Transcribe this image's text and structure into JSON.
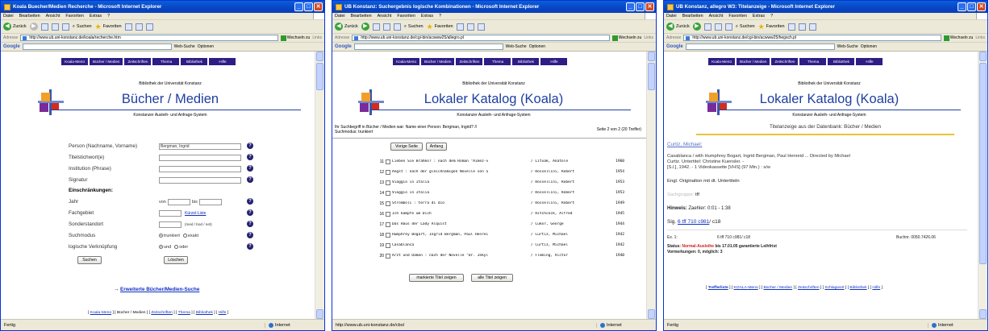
{
  "common": {
    "menu": [
      "Datei",
      "Bearbeiten",
      "Ansicht",
      "Favoriten",
      "Extras",
      "?"
    ],
    "toolbar": {
      "back": "Zurück",
      "search": "Suchen",
      "favorites": "Favoriten"
    },
    "address_label": "Adresse",
    "go_label": "Wechseln zu",
    "links_label": "Links",
    "google": {
      "logo": "Google",
      "web_search": "Web-Suche",
      "options": "Optionen"
    },
    "nav": [
      "Koala-Menü",
      "Bücher / Medien",
      "Zeitschriften",
      "Thema",
      "Bibliothek",
      "Hilfe"
    ],
    "library": "Bibliothek der Universität Konstanz",
    "subtitle": "Konstanzer Ausleih- und Anfrage-System",
    "zone": "Internet"
  },
  "win1": {
    "title": "Koala Buecher/Medien Recherche - Microsoft Internet Explorer",
    "url": "http://www.ub.uni-konstanz.de/koala/recherche.htm",
    "heading": "Bücher / Medien",
    "fields": [
      {
        "label": "Person (Nachname, Vorname)",
        "value": "Bergman, Ingrid"
      },
      {
        "label": "Titelstichwort(e)",
        "value": ""
      },
      {
        "label": "Institution (Phrase)",
        "value": ""
      },
      {
        "label": "Signatur",
        "value": ""
      }
    ],
    "restrictions": "Einschränkungen:",
    "year_label": "Jahr",
    "year_from": "von",
    "year_to": "bis",
    "subject_label": "Fachgebiet",
    "shortlist": "Kürzel-Liste",
    "location_label": "Sonderstandort",
    "location_hint": "(med / bod / net)",
    "mode_label": "Suchmodus",
    "mode_options": [
      "trunkiert",
      "exakt"
    ],
    "logic_label": "logische Verknüpfung",
    "logic_options": [
      "und",
      "oder"
    ],
    "search_btn": "Suchen",
    "clear_btn": "Löschen",
    "extended": "Erweiterte Bücher/Medien-Suche",
    "footer": [
      {
        "text": "Koala-Menü",
        "link": true
      },
      {
        "text": "Bücher / Medien",
        "link": false
      },
      {
        "text": "Zeitschriften",
        "link": true
      },
      {
        "text": "Thema",
        "link": true
      },
      {
        "text": "Bibliothek",
        "link": true
      },
      {
        "text": "Hilfe",
        "link": true
      }
    ],
    "status": "Fertig"
  },
  "win2": {
    "title": "UB Konstanz: Suchergebnis logische Kombinationen - Microsoft Internet Explorer",
    "url": "http://www.ub.uni-konstanz.de/cgi-bin/acwww25/allegro.pl",
    "heading": "Lokaler Katalog (Koala)",
    "query_line1": "Ihr Suchbegriff in Bücher / Medien war: Name einer Person: Bergman, Ingrid? //",
    "query_line2": "Suchmodus: trunkiert",
    "page_info": "Seite 2 von 2 (20 Treffer)",
    "prev_btn": "Vorige Seite",
    "start_btn": "Anfang",
    "results": [
      {
        "n": "11",
        "title": "Lieben Sie Brahms? : nach dem Roman \"Aimez-v",
        "author": "/ Litvak, Anatole",
        "year": "1960"
      },
      {
        "n": "12",
        "title": "Angst : nach der gleichnamigen Novelle von S",
        "author": "/ Rossellini, Robert",
        "year": "1954"
      },
      {
        "n": "13",
        "title": "Viaggio in Italia",
        "author": "/ Rossellini, Robert",
        "year": "1953"
      },
      {
        "n": "14",
        "title": "Viaggio in Italia",
        "author": "/ Rossellini, Robert",
        "year": "1953"
      },
      {
        "n": "15",
        "title": "Stromboli : terra di dio",
        "author": "/ Rossellini, Robert",
        "year": "1949"
      },
      {
        "n": "16",
        "title": "Ich kämpfe um Dich",
        "author": "/ Hitchcock, Alfred",
        "year": "1945"
      },
      {
        "n": "17",
        "title": "Das Haus der Lady Alquist",
        "author": "/ Cukor, George",
        "year": "1944"
      },
      {
        "n": "18",
        "title": "Humphrey Bogart, Ingrid Bergman, Paul Henrei",
        "author": "/ Curtiz, Michael",
        "year": "1942"
      },
      {
        "n": "19",
        "title": "Casablanca",
        "author": "/ Curtiz, Michael",
        "year": "1942"
      },
      {
        "n": "20",
        "title": "Arzt und Dämon : nach der Novelle \"Dr. Jekyl",
        "author": "/ Fleming, Victor",
        "year": "1940"
      }
    ],
    "show_marked": "markierte Titel zeigen",
    "show_all": "alle Titel zeigen",
    "status": "http://www.ub.uni-konstanz.de/cbo/"
  },
  "win3": {
    "title": "UB Konstanz, allegro W3: Titelanzeige - Microsoft Internet Explorer",
    "url": "http://www.ub.uni-konstanz.de/cgi-bin/acwww25/hegsch.pl",
    "heading": "Lokaler Katalog (Koala)",
    "db_line": "Titelanzeige aus der Datenbank: Bücher / Medien",
    "author_link": "Curtiz, Michael:",
    "desc": [
      "Casablanca / with Humphrey Bogart, Ingrid Bergman, Paul Henreid ... Directed by Michael",
      "Curtiz. Untertitel: Christine Kuensler. -",
      "[S.l.], 1942. - 1 Videokassette [VHS] (97 Min.) : s/w"
    ],
    "lang": "Engl. Originalton mit dt. Untertiteln",
    "group_label": "Sachgruppe:",
    "group_val": "tff",
    "note_label": "Hinweis:",
    "note_val": "Zaehler: 0:01 - 1:38",
    "sig_label": "Sig.",
    "sig_link": "6 tff 710 c981",
    "sig_suffix": "/ c18",
    "ex_label": "Ex. 1:",
    "ex_sig": "6 tff 710 c981/ c18",
    "ex_nr": "Buchnr. 0050.7426.06",
    "status_label": "Status:",
    "status_val": "Normal-Ausleihe",
    "status_rest": "bis 17.01.05 garantierte Leihfrist",
    "reserv": "Vormerkungen: 0, möglich: 3",
    "footer": [
      "Trefferliste",
      "KOALA-Menü",
      "Bücher / Medien",
      "Zeitschriften",
      "Schlagwort",
      "Bibliothek",
      "Hilfe"
    ],
    "status": "Fertig"
  },
  "colors": {
    "nav": "#2e1d85",
    "title": "#1f3fa0",
    "titlebar": "#0845c4"
  }
}
